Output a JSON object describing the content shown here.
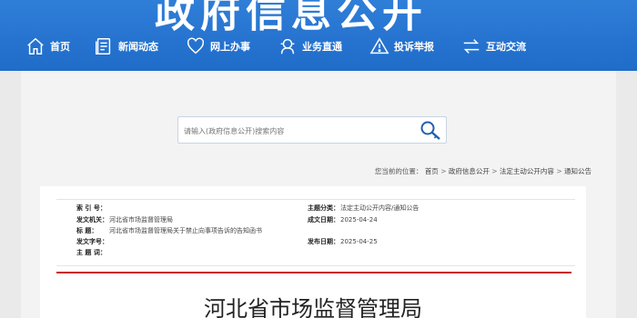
{
  "banner": {
    "title": "政府信息公开"
  },
  "nav": [
    {
      "label": "首页",
      "icon": "home-icon"
    },
    {
      "label": "新闻动态",
      "icon": "news-icon"
    },
    {
      "label": "网上办事",
      "icon": "heart-icon"
    },
    {
      "label": "业务直通",
      "icon": "service-icon"
    },
    {
      "label": "投诉举报",
      "icon": "warning-icon"
    },
    {
      "label": "互动交流",
      "icon": "exchange-icon"
    }
  ],
  "search": {
    "placeholder": "请输入(政府信息公开)搜索内容"
  },
  "breadcrumb": {
    "prefix": "您当前的位置：",
    "items": [
      "首页",
      "政府信息公开",
      "法定主动公开内容",
      "通知公告"
    ],
    "separator": " > "
  },
  "meta": {
    "index_no_label": "索 引 号：",
    "index_no": "",
    "issuer_label": "发文机关：",
    "issuer": "河北省市场监督管理局",
    "title_label": "标 题：",
    "title": "河北省市场监督管理局关于禁止向事项告诉的告知函书",
    "doc_no_label": "发文字号：",
    "doc_no": "",
    "subject_label": "主 题 词：",
    "subject": "",
    "category_label": "主题分类：",
    "category": "法定主动公开内容/通知公告",
    "created_label": "成文日期：",
    "created": "2025-04-24",
    "published_label": "发布日期：",
    "published": "2025-04-25"
  },
  "document": {
    "title": "河北省市场监督管理局"
  },
  "colors": {
    "banner": "#2f7ed8",
    "accent_red": "#c81d1d"
  }
}
